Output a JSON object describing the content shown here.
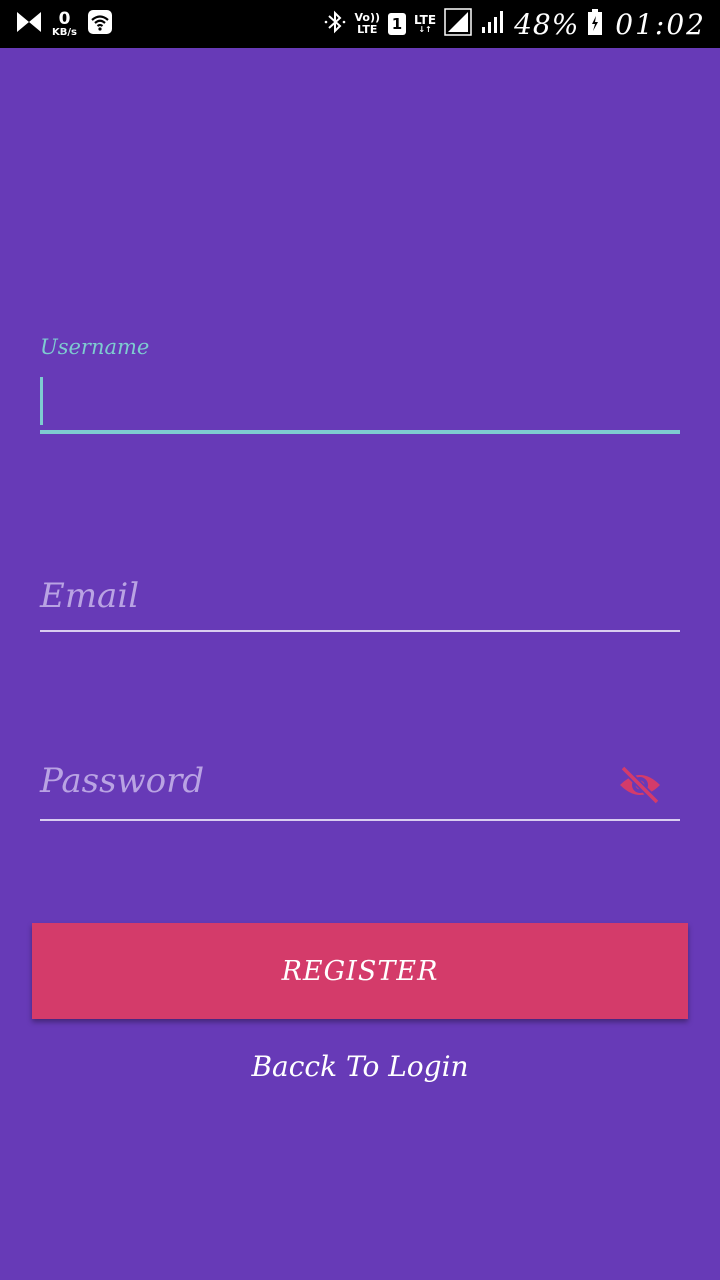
{
  "status_bar": {
    "net_speed_value": "0",
    "net_speed_unit": "KB/s",
    "volte_top": "Vo))",
    "volte_bottom": "LTE",
    "sim_slot": "1",
    "lte_label": "LTE",
    "lte_arrows": "↓↑",
    "battery_percent": "48%",
    "time": "01:02",
    "icons": [
      "notification-bowtie-icon",
      "wifi-icon",
      "bluetooth-icon",
      "signal-icon",
      "signal-icon",
      "battery-icon"
    ]
  },
  "form": {
    "username_label": "Username",
    "username_value": "",
    "email_placeholder": "Email",
    "password_placeholder": "Password",
    "password_toggle_icon": "eye-off-icon"
  },
  "actions": {
    "register_label": "REGISTER",
    "back_to_login_label": "Bacck To Login"
  },
  "colors": {
    "background": "#673ab7",
    "accent_teal": "#7ecbd0",
    "button_pink": "#d43b6a",
    "placeholder": "#b9a3e3"
  }
}
